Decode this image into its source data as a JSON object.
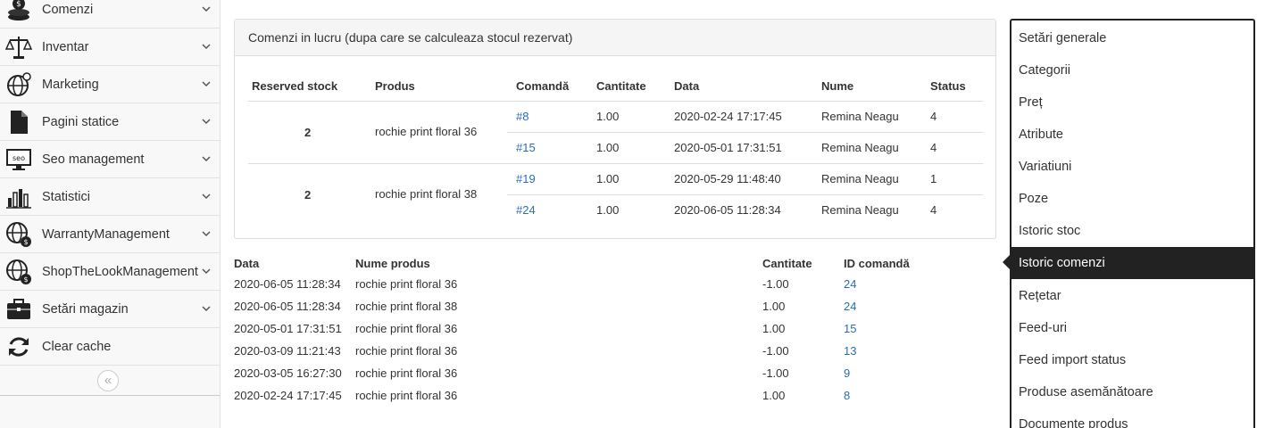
{
  "sidebar": {
    "items": [
      {
        "label": "Comenzi",
        "icon": "coins-icon"
      },
      {
        "label": "Inventar",
        "icon": "scale-icon"
      },
      {
        "label": "Marketing",
        "icon": "globe-icon"
      },
      {
        "label": "Pagini statice",
        "icon": "file-icon"
      },
      {
        "label": "Seo management",
        "icon": "seo-monitor-icon"
      },
      {
        "label": "Statistici",
        "icon": "bar-chart-icon"
      },
      {
        "label": "WarrantyManagement",
        "icon": "globe-dollar-icon"
      },
      {
        "label": "ShopTheLookManagement",
        "icon": "globe-dollar-icon"
      },
      {
        "label": "Setări magazin",
        "icon": "briefcase-icon"
      },
      {
        "label": "Clear cache",
        "icon": "refresh-icon"
      }
    ],
    "collapse_symbol": "«"
  },
  "panel": {
    "title": "Comenzi in lucru (dupa care se calculeaza stocul rezervat)",
    "headers": [
      "Reserved stock",
      "Produs",
      "Comandă",
      "Cantitate",
      "Data",
      "Nume",
      "Status"
    ],
    "groups": [
      {
        "reserved": "2",
        "product": "rochie print floral 36",
        "orders": [
          {
            "order": "#8",
            "qty": "1.00",
            "date": "2020-02-24 17:17:45",
            "name": "Remina Neagu",
            "status": "4"
          },
          {
            "order": "#15",
            "qty": "1.00",
            "date": "2020-05-01 17:31:51",
            "name": "Remina Neagu",
            "status": "4"
          }
        ]
      },
      {
        "reserved": "2",
        "product": "rochie print floral 38",
        "orders": [
          {
            "order": "#19",
            "qty": "1.00",
            "date": "2020-05-29 11:48:40",
            "name": "Remina Neagu",
            "status": "1"
          },
          {
            "order": "#24",
            "qty": "1.00",
            "date": "2020-06-05 11:28:34",
            "name": "Remina Neagu",
            "status": "4"
          }
        ]
      }
    ]
  },
  "history": {
    "headers": [
      "Data",
      "Nume produs",
      "Cantitate",
      "ID comandă"
    ],
    "rows": [
      {
        "date": "2020-06-05 11:28:34",
        "product": "rochie print floral 36",
        "qty": "-1.00",
        "id": "24"
      },
      {
        "date": "2020-06-05 11:28:34",
        "product": "rochie print floral 38",
        "qty": "1.00",
        "id": "24"
      },
      {
        "date": "2020-05-01 17:31:51",
        "product": "rochie print floral 36",
        "qty": "1.00",
        "id": "15"
      },
      {
        "date": "2020-03-09 11:21:43",
        "product": "rochie print floral 36",
        "qty": "-1.00",
        "id": "13"
      },
      {
        "date": "2020-03-05 16:27:30",
        "product": "rochie print floral 36",
        "qty": "-1.00",
        "id": "9"
      },
      {
        "date": "2020-02-24 17:17:45",
        "product": "rochie print floral 36",
        "qty": "1.00",
        "id": "8"
      }
    ]
  },
  "right_menu": {
    "items": [
      "Setări generale",
      "Categorii",
      "Preț",
      "Atribute",
      "Variatiuni",
      "Poze",
      "Istoric stoc",
      "Istoric comenzi",
      "Rețetar",
      "Feed-uri",
      "Feed import status",
      "Produse asemănătoare",
      "Documente produs"
    ],
    "active": "Istoric comenzi"
  },
  "colors": {
    "link": "#2a6ebb",
    "active_bg": "#222222"
  }
}
